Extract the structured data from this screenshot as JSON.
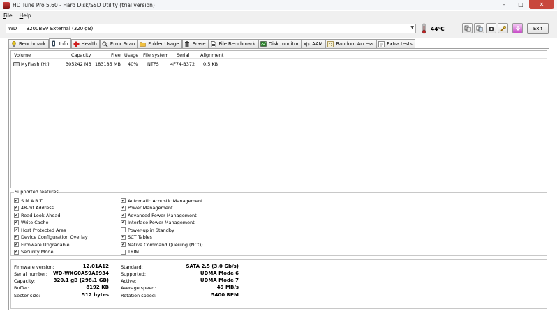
{
  "window": {
    "title": "HD Tune Pro 5.60 - Hard Disk/SSD Utility (trial version)"
  },
  "menu": [
    {
      "accel": "F",
      "rest": "ile"
    },
    {
      "accel": "H",
      "rest": "elp"
    }
  ],
  "device": {
    "selected": "WD      3200BEV External (320 gB)",
    "temperature": "44°C",
    "exit_label": "Exit"
  },
  "tabs": [
    {
      "label": "Benchmark",
      "icon": "benchmark-icon"
    },
    {
      "label": "Info",
      "icon": "info-icon"
    },
    {
      "label": "Health",
      "icon": "health-icon"
    },
    {
      "label": "Error Scan",
      "icon": "error-scan-icon"
    },
    {
      "label": "Folder Usage",
      "icon": "folder-icon"
    },
    {
      "label": "Erase",
      "icon": "erase-icon"
    },
    {
      "label": "File Benchmark",
      "icon": "file-benchmark-icon"
    },
    {
      "label": "Disk monitor",
      "icon": "disk-monitor-icon"
    },
    {
      "label": "AAM",
      "icon": "speaker-icon"
    },
    {
      "label": "Random Access",
      "icon": "random-access-icon"
    },
    {
      "label": "Extra tests",
      "icon": "extra-tests-icon"
    }
  ],
  "volumes": {
    "columns": [
      "Volume",
      "Capacity",
      "Free",
      "Usage",
      "File system",
      "Serial",
      "Alignment"
    ],
    "rows": [
      [
        "MyFlash (H:)",
        "305242 MB",
        "183185 MB",
        "40%",
        "NTFS",
        "4F74-B372",
        "0.5 KB"
      ]
    ]
  },
  "features": {
    "legend": "Supported features",
    "left": [
      {
        "label": "S.M.A.R.T",
        "checked": true
      },
      {
        "label": "48-bit Address",
        "checked": true
      },
      {
        "label": "Read Look-Ahead",
        "checked": true
      },
      {
        "label": "Write Cache",
        "checked": true
      },
      {
        "label": "Host Protected Area",
        "checked": true
      },
      {
        "label": "Device Configuration Overlay",
        "checked": true
      },
      {
        "label": "Firmware Upgradable",
        "checked": true
      },
      {
        "label": "Security Mode",
        "checked": true
      }
    ],
    "right": [
      {
        "label": "Automatic Acoustic Management",
        "checked": true
      },
      {
        "label": "Power Management",
        "checked": true
      },
      {
        "label": "Advanced Power Management",
        "checked": true
      },
      {
        "label": "Interface Power Management",
        "checked": true
      },
      {
        "label": "Power-up in Standby",
        "checked": false
      },
      {
        "label": "SCT Tables",
        "checked": true
      },
      {
        "label": "Native Command Queuing (NCQ)",
        "checked": true
      },
      {
        "label": "TRIM",
        "checked": false
      }
    ]
  },
  "info": {
    "left": [
      {
        "label": "Firmware version:",
        "value": "12.01A12"
      },
      {
        "label": "Serial number:",
        "value": "WD-WXG0A59A6934"
      },
      {
        "label": "Capacity:",
        "value": "320.1 gB (298.1 GB)"
      },
      {
        "label": "Buffer:",
        "value": "8192 KB"
      },
      {
        "label": "Sector size:",
        "value": "512 bytes"
      }
    ],
    "right": [
      {
        "label": "Standard:",
        "value": "SATA 2.5 (3.0 Gb/s)"
      },
      {
        "label": "Supported:",
        "value": "UDMA Mode 6"
      },
      {
        "label": "Active:",
        "value": "UDMA Mode 7"
      },
      {
        "label": "Average speed:",
        "value": "49 MB/s"
      },
      {
        "label": "Rotation speed:",
        "value": "5400 RPM"
      }
    ]
  }
}
